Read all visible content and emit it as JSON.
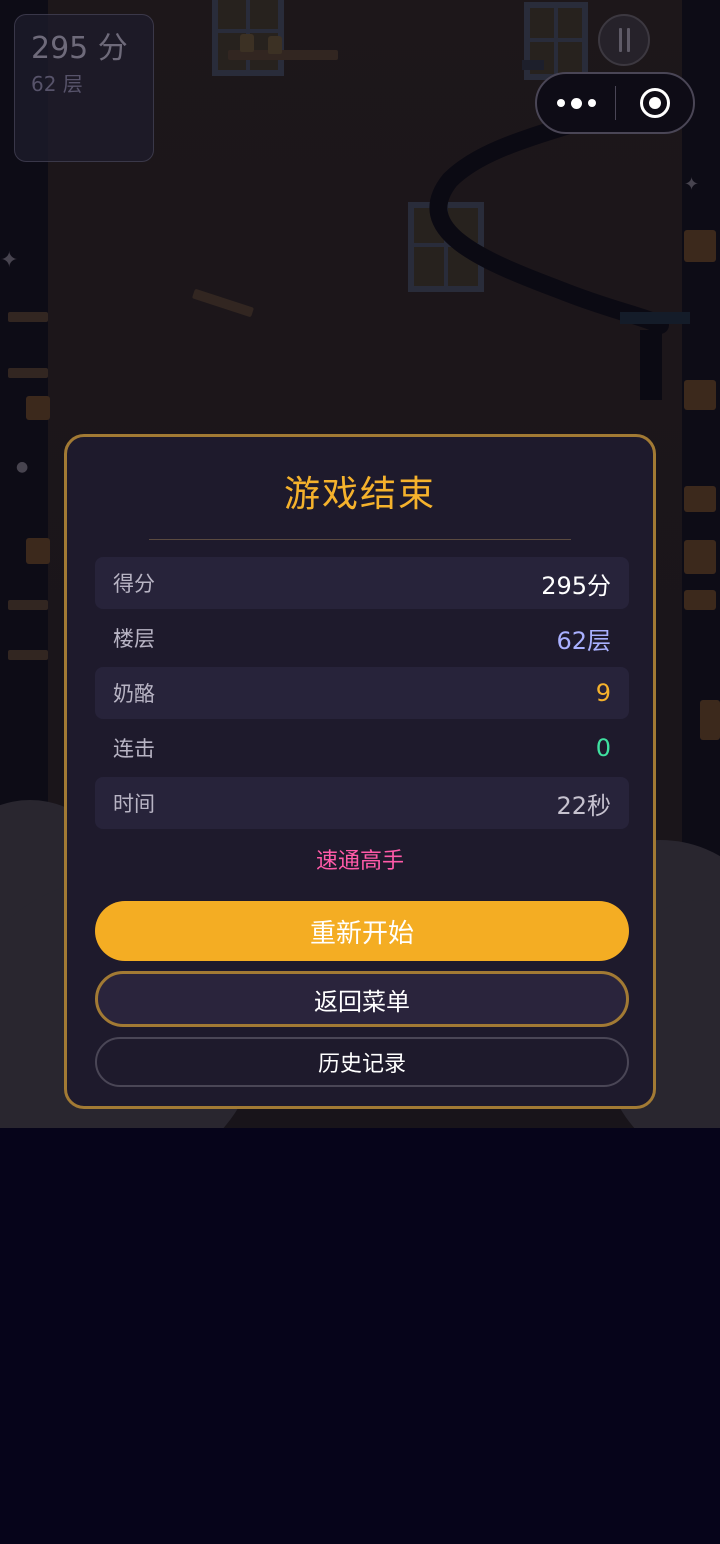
{
  "hud": {
    "score": "295 分",
    "floor": "62 层"
  },
  "top_controls": {
    "pause_icon": "pause-icon",
    "more_icon": "more-dots-icon",
    "close_icon": "record-circle-icon"
  },
  "result": {
    "title": "游戏结束",
    "stats": [
      {
        "label": "得分",
        "value": "295分"
      },
      {
        "label": "楼层",
        "value": "62层"
      },
      {
        "label": "奶酪",
        "value": "9"
      },
      {
        "label": "连击",
        "value": "0"
      },
      {
        "label": "时间",
        "value": "22秒"
      }
    ],
    "rank": "速通高手",
    "restart_label": "重新开始",
    "menu_label": "返回菜单",
    "history_label": "历史记录"
  },
  "colors": {
    "accent": "#f4ad23",
    "border_gold": "#a27a34",
    "panel": "#1e1a2c",
    "rank_pink": "#ff5aa8",
    "floor_blue": "#a9b0ff",
    "combo_green": "#3fe0a0"
  }
}
